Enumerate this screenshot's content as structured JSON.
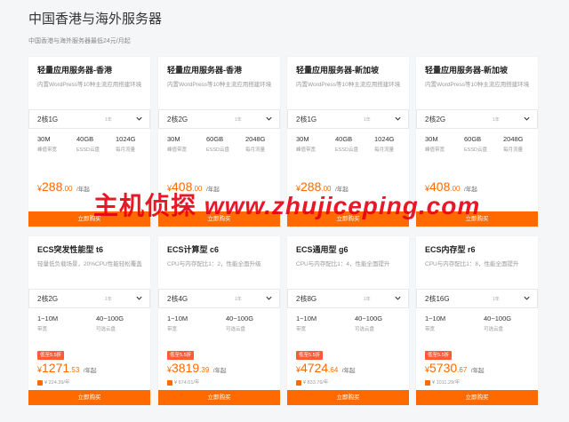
{
  "header": {
    "title": "中国香港与海外服务器",
    "subtitle": "中国香港与海外服务器最低24元/月起"
  },
  "watermark": {
    "cn": "主机侦探",
    "en": "www.zhujiceping.com"
  },
  "colors": {
    "accent": "#ff6a00",
    "badge": "#ff5b37",
    "watermark": "#e60012"
  },
  "row1": [
    {
      "title": "轻量应用服务器-香港",
      "desc": "内置WordPress等10种主流应用搭建环境",
      "select": "2核1G",
      "select_unit": "1年",
      "specs": [
        {
          "val": "30M",
          "lbl": "峰值带宽"
        },
        {
          "val": "40GB",
          "lbl": "ESSD云盘"
        },
        {
          "val": "1024G",
          "lbl": "每月流量"
        }
      ],
      "price": {
        "cur": "¥",
        "int": "288",
        "dec": ".00",
        "unit": "/年起"
      },
      "buy": "立即购买"
    },
    {
      "title": "轻量应用服务器-香港",
      "desc": "内置WordPress等10种主流应用搭建环境",
      "select": "2核2G",
      "select_unit": "1年",
      "specs": [
        {
          "val": "30M",
          "lbl": "峰值带宽"
        },
        {
          "val": "60GB",
          "lbl": "ESSD云盘"
        },
        {
          "val": "2048G",
          "lbl": "每月流量"
        }
      ],
      "price": {
        "cur": "¥",
        "int": "408",
        "dec": ".00",
        "unit": "/年起"
      },
      "buy": "立即购买"
    },
    {
      "title": "轻量应用服务器-新加坡",
      "desc": "内置WordPress等10种主流应用搭建环境",
      "select": "2核1G",
      "select_unit": "1年",
      "specs": [
        {
          "val": "30M",
          "lbl": "峰值带宽"
        },
        {
          "val": "40GB",
          "lbl": "ESSD云盘"
        },
        {
          "val": "1024G",
          "lbl": "每月流量"
        }
      ],
      "price": {
        "cur": "¥",
        "int": "288",
        "dec": ".00",
        "unit": "/年起"
      },
      "buy": "立即购买"
    },
    {
      "title": "轻量应用服务器-新加坡",
      "desc": "内置WordPress等10种主流应用搭建环境",
      "select": "2核2G",
      "select_unit": "1年",
      "specs": [
        {
          "val": "30M",
          "lbl": "峰值带宽"
        },
        {
          "val": "60GB",
          "lbl": "ESSD云盘"
        },
        {
          "val": "2048G",
          "lbl": "每月流量"
        }
      ],
      "price": {
        "cur": "¥",
        "int": "408",
        "dec": ".00",
        "unit": "/年起"
      },
      "buy": "立即购买"
    }
  ],
  "row2": [
    {
      "title": "ECS突发性能型 t6",
      "desc": "轻量低负载场景，20%CPU性能轻松覆盖",
      "select": "2核2G",
      "select_unit": "1年",
      "specs": [
        {
          "val": "1~10M",
          "lbl": "带宽"
        },
        {
          "val": "40~100G",
          "lbl": "可选云盘"
        }
      ],
      "badge": "低至5.5折",
      "price": {
        "cur": "¥",
        "int": "1271",
        "dec": ".53",
        "unit": "/年起"
      },
      "orig": "¥ 224.39/年",
      "buy": "立即购买"
    },
    {
      "title": "ECS计算型 c6",
      "desc": "CPU与内存配比1：2，性能全面升级",
      "select": "2核4G",
      "select_unit": "1年",
      "specs": [
        {
          "val": "1~10M",
          "lbl": "带宽"
        },
        {
          "val": "40~100G",
          "lbl": "可选云盘"
        }
      ],
      "badge": "低至5.5折",
      "price": {
        "cur": "¥",
        "int": "3819",
        "dec": ".39",
        "unit": "/年起"
      },
      "orig": "¥ 674.01/年",
      "buy": "立即购买"
    },
    {
      "title": "ECS通用型 g6",
      "desc": "CPU与内存配比1：4，性能全面提升",
      "select": "2核8G",
      "select_unit": "1年",
      "specs": [
        {
          "val": "1~10M",
          "lbl": "带宽"
        },
        {
          "val": "40~100G",
          "lbl": "可选云盘"
        }
      ],
      "badge": "低至5.5折",
      "price": {
        "cur": "¥",
        "int": "4724",
        "dec": ".64",
        "unit": "/年起"
      },
      "orig": "¥ 833.76/年",
      "buy": "立即购买"
    },
    {
      "title": "ECS内存型 r6",
      "desc": "CPU与内存配比1：8，性能全面提升",
      "select": "2核16G",
      "select_unit": "1年",
      "specs": [
        {
          "val": "1~10M",
          "lbl": "带宽"
        },
        {
          "val": "40~100G",
          "lbl": "可选云盘"
        }
      ],
      "badge": "低至5.5折",
      "price": {
        "cur": "¥",
        "int": "5730",
        "dec": ".67",
        "unit": "/年起"
      },
      "orig": "¥ 1011.29/年",
      "buy": "立即购买"
    }
  ]
}
